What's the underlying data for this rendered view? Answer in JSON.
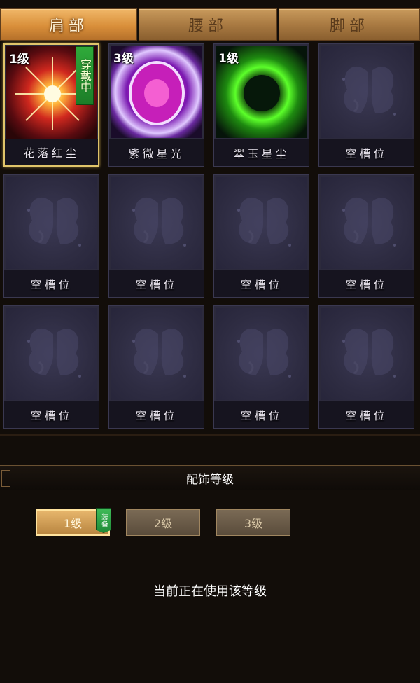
{
  "tabs": [
    {
      "label": "肩部",
      "active": true
    },
    {
      "label": "腰部",
      "active": false
    },
    {
      "label": "脚部",
      "active": false
    }
  ],
  "slots": [
    {
      "name": "花落红尘",
      "level": "1级",
      "wearing_tag": "穿戴中",
      "art": "red-starburst-icon"
    },
    {
      "name": "紫微星光",
      "level": "3级",
      "art": "purple-orb-icon"
    },
    {
      "name": "翠玉星尘",
      "level": "1级",
      "art": "green-orb-icon"
    },
    {
      "name": "空槽位",
      "art": "butterfly-icon"
    },
    {
      "name": "空槽位",
      "art": "butterfly-icon"
    },
    {
      "name": "空槽位",
      "art": "butterfly-icon"
    },
    {
      "name": "空槽位",
      "art": "butterfly-icon"
    },
    {
      "name": "空槽位",
      "art": "butterfly-icon"
    },
    {
      "name": "空槽位",
      "art": "butterfly-icon"
    },
    {
      "name": "空槽位",
      "art": "butterfly-icon"
    },
    {
      "name": "空槽位",
      "art": "butterfly-icon"
    },
    {
      "name": "空槽位",
      "art": "butterfly-icon"
    }
  ],
  "grade_panel": {
    "title": "配饰等级",
    "levels": [
      "1级",
      "2级",
      "3级"
    ],
    "active_level": "1级",
    "equip_badge": "装备",
    "status": "当前正在使用该等级"
  },
  "colors": {
    "accent_gold": "#e0c46a",
    "wearing_green": "#2faa3a",
    "slot_bg": "#2c2a3c"
  }
}
